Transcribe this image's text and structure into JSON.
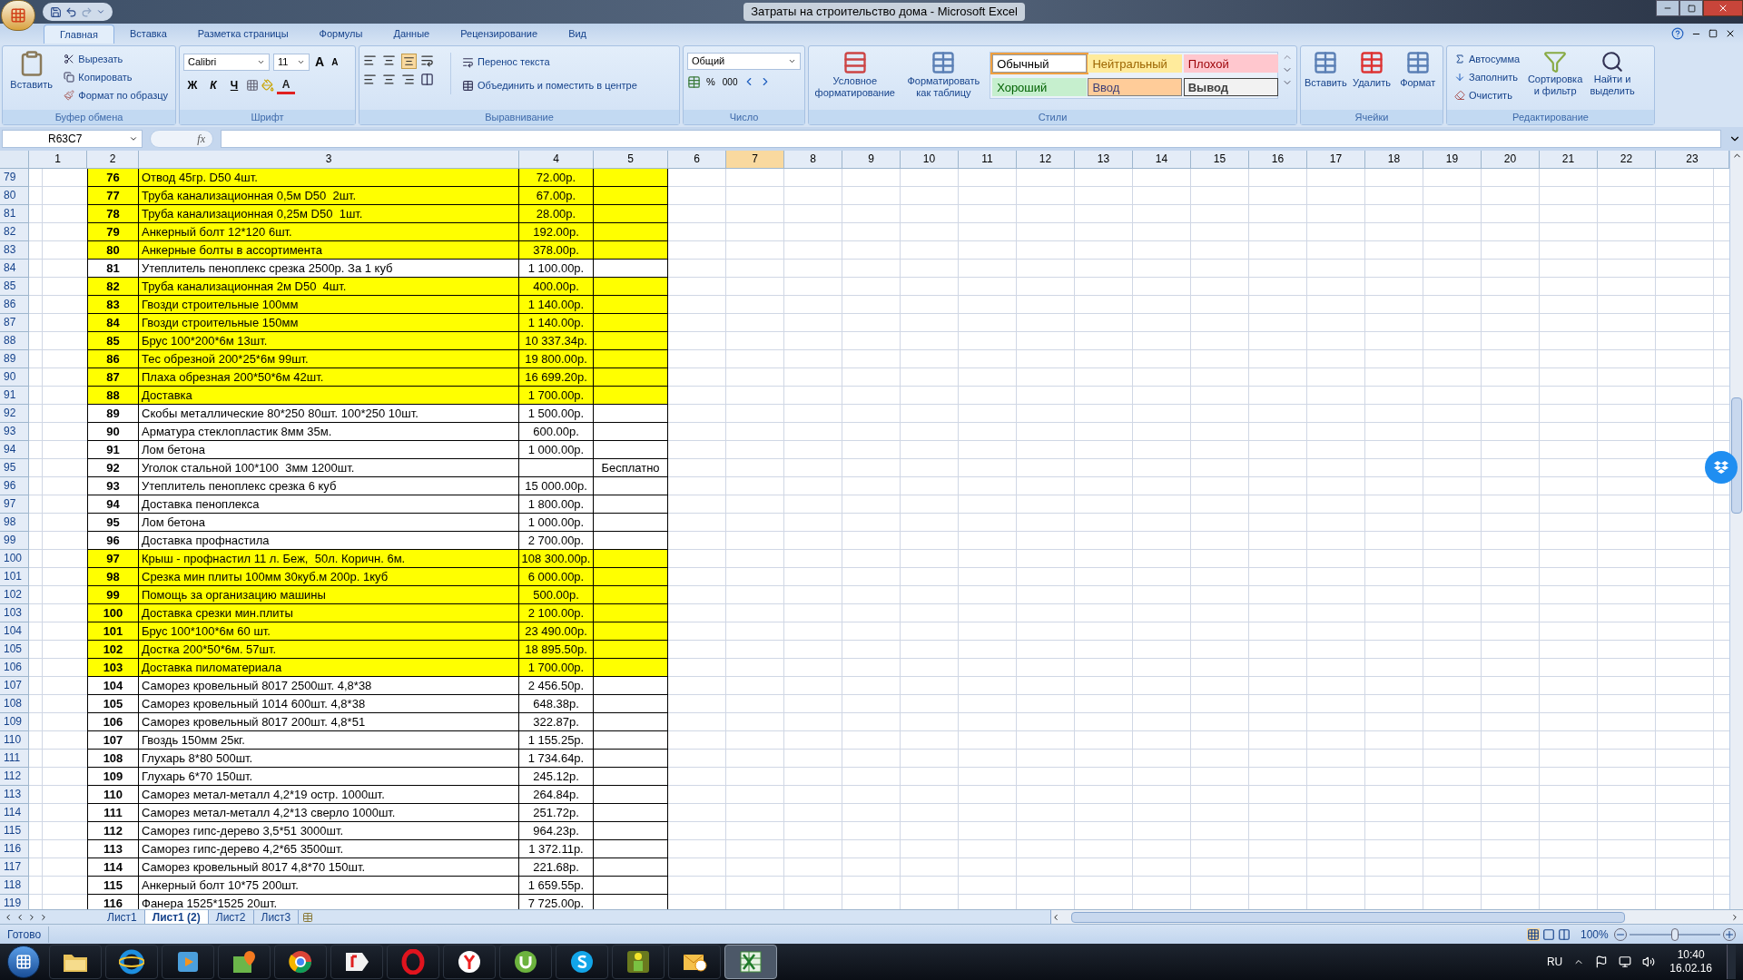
{
  "window": {
    "title": "Затраты на строительство дома - Microsoft Excel"
  },
  "ribbon_tabs": [
    {
      "label": "Главная",
      "selected": true
    },
    {
      "label": "Вставка",
      "selected": false
    },
    {
      "label": "Разметка страницы",
      "selected": false
    },
    {
      "label": "Формулы",
      "selected": false
    },
    {
      "label": "Данные",
      "selected": false
    },
    {
      "label": "Рецензирование",
      "selected": false
    },
    {
      "label": "Вид",
      "selected": false
    }
  ],
  "clipboard": {
    "paste": "Вставить",
    "cut": "Вырезать",
    "copy": "Копировать",
    "format_painter": "Формат по образцу",
    "label": "Буфер обмена"
  },
  "font": {
    "name": "Calibri",
    "size": "11",
    "grow": "A",
    "shrink": "A",
    "bold": "Ж",
    "italic": "К",
    "underline": "Ч",
    "font_color": "A",
    "label": "Шрифт"
  },
  "alignment": {
    "wrap": "Перенос текста",
    "merge": "Объединить и поместить в центре",
    "label": "Выравнивание"
  },
  "number": {
    "format": "Общий",
    "percent": "%",
    "thousands": "000",
    "label": "Число"
  },
  "styles": {
    "conditional": "Условное форматирование",
    "as_table": "Форматировать как таблицу",
    "label": "Стили",
    "items": [
      {
        "label": "Обычный",
        "kind": "normal",
        "color": "#ffffff",
        "selected": true
      },
      {
        "label": "Нейтральный",
        "kind": "neutral",
        "color": "#ffeb9c",
        "selected": false
      },
      {
        "label": "Плохой",
        "kind": "bad",
        "color": "#ffc7ce",
        "selected": false
      },
      {
        "label": "Хороший",
        "kind": "good",
        "color": "#c6efce",
        "selected": false
      },
      {
        "label": "Ввод",
        "kind": "input",
        "color": "#ffcc99",
        "selected": false
      },
      {
        "label": "Вывод",
        "kind": "output",
        "color": "#f2f2f2",
        "selected": false
      }
    ]
  },
  "cells": {
    "insert": "Вставить",
    "delete": "Удалить",
    "format": "Формат",
    "label": "Ячейки"
  },
  "editing": {
    "autosum": "Автосумма",
    "fill": "Заполнить",
    "clear": "Очистить",
    "sort": "Сортировка и фильтр",
    "find": "Найти и выделить",
    "label": "Редактирование"
  },
  "formula_bar": {
    "name_box": "R63C7",
    "fx": "fx"
  },
  "columns": [
    {
      "label": "1",
      "selected": false
    },
    {
      "label": "2",
      "selected": false
    },
    {
      "label": "3",
      "selected": false
    },
    {
      "label": "4",
      "selected": false
    },
    {
      "label": "5",
      "selected": false
    },
    {
      "label": "6",
      "selected": false
    },
    {
      "label": "7",
      "selected": true
    },
    {
      "label": "8",
      "selected": false
    },
    {
      "label": "9",
      "selected": false
    },
    {
      "label": "10",
      "selected": false
    },
    {
      "label": "11",
      "selected": false
    },
    {
      "label": "12",
      "selected": false
    },
    {
      "label": "13",
      "selected": false
    },
    {
      "label": "14",
      "selected": false
    },
    {
      "label": "15",
      "selected": false
    },
    {
      "label": "16",
      "selected": false
    },
    {
      "label": "17",
      "selected": false
    },
    {
      "label": "18",
      "selected": false
    },
    {
      "label": "19",
      "selected": false
    },
    {
      "label": "20",
      "selected": false
    },
    {
      "label": "21",
      "selected": false
    },
    {
      "label": "22",
      "selected": false
    },
    {
      "label": "23",
      "selected": false
    }
  ],
  "rows": [
    {
      "row": "79",
      "num": "76",
      "name": "Отвод 45гр. D50 4шт.",
      "price": "72.00р.",
      "highlighted": true
    },
    {
      "row": "80",
      "num": "77",
      "name": "Труба канализационная 0,5м D50  2шт.",
      "price": "67.00р.",
      "highlighted": true
    },
    {
      "row": "81",
      "num": "78",
      "name": "Труба канализационная 0,25м D50  1шт.",
      "price": "28.00р.",
      "highlighted": true
    },
    {
      "row": "82",
      "num": "79",
      "name": "Анкерный болт 12*120 6шт.",
      "price": "192.00р.",
      "highlighted": true
    },
    {
      "row": "83",
      "num": "80",
      "name": "Анкерные болты в ассортимента",
      "price": "378.00р.",
      "highlighted": true
    },
    {
      "row": "84",
      "num": "81",
      "name": "Утеплитель пеноплекс срезка 2500р. За 1 куб",
      "price": "1 100.00р.",
      "highlighted": false
    },
    {
      "row": "85",
      "num": "82",
      "name": "Труба канализационная 2м D50  4шт.",
      "price": "400.00р.",
      "highlighted": true
    },
    {
      "row": "86",
      "num": "83",
      "name": "Гвозди строительные 100мм",
      "price": "1 140.00р.",
      "highlighted": true
    },
    {
      "row": "87",
      "num": "84",
      "name": "Гвозди строительные 150мм",
      "price": "1 140.00р.",
      "highlighted": true
    },
    {
      "row": "88",
      "num": "85",
      "name": "Брус 100*200*6м 13шт.",
      "price": "10 337.34р.",
      "highlighted": true
    },
    {
      "row": "89",
      "num": "86",
      "name": "Тес обрезной 200*25*6м 99шт.",
      "price": "19 800.00р.",
      "highlighted": true
    },
    {
      "row": "90",
      "num": "87",
      "name": "Плаха обрезная 200*50*6м 42шт.",
      "price": "16 699.20р.",
      "highlighted": true
    },
    {
      "row": "91",
      "num": "88",
      "name": "Доставка",
      "price": "1 700.00р.",
      "highlighted": true
    },
    {
      "row": "92",
      "num": "89",
      "name": "Скобы металлические 80*250 80шт. 100*250 10шт.",
      "price": "1 500.00р.",
      "highlighted": false
    },
    {
      "row": "93",
      "num": "90",
      "name": "Арматура стеклопластик 8мм 35м.",
      "price": "600.00р.",
      "highlighted": false
    },
    {
      "row": "94",
      "num": "91",
      "name": "Лом бетона",
      "price": "1 000.00р.",
      "highlighted": false
    },
    {
      "row": "95",
      "num": "92",
      "name": "Уголок стальной 100*100  3мм 1200шт.",
      "note": "Бесплатно",
      "highlighted": false
    },
    {
      "row": "96",
      "num": "93",
      "name": "Утеплитель пеноплекс срезка 6 куб",
      "price": "15 000.00р.",
      "highlighted": false
    },
    {
      "row": "97",
      "num": "94",
      "name": "Доставка пеноплекса",
      "price": "1 800.00р.",
      "highlighted": false
    },
    {
      "row": "98",
      "num": "95",
      "name": "Лом бетона",
      "price": "1 000.00р.",
      "highlighted": false
    },
    {
      "row": "99",
      "num": "96",
      "name": "Доставка профнастила",
      "price": "2 700.00р.",
      "highlighted": false
    },
    {
      "row": "100",
      "num": "97",
      "name": "Крыш - профнастил 11 л. Беж,  50л. Коричн. 6м.",
      "price": "108 300.00р.",
      "highlighted": true
    },
    {
      "row": "101",
      "num": "98",
      "name": "Срезка мин плиты 100мм 30куб.м 200р. 1куб",
      "price": "6 000.00р.",
      "highlighted": true
    },
    {
      "row": "102",
      "num": "99",
      "name": "Помощь за организацию машины",
      "price": "500.00р.",
      "highlighted": true
    },
    {
      "row": "103",
      "num": "100",
      "name": "Доставка срезки мин.плиты",
      "price": "2 100.00р.",
      "highlighted": true
    },
    {
      "row": "104",
      "num": "101",
      "name": "Брус 100*100*6м 60 шт.",
      "price": "23 490.00р.",
      "highlighted": true
    },
    {
      "row": "105",
      "num": "102",
      "name": "Достка 200*50*6м. 57шт.",
      "price": "18 895.50р.",
      "highlighted": true
    },
    {
      "row": "106",
      "num": "103",
      "name": "Доставка пиломатериала",
      "price": "1 700.00р.",
      "highlighted": true
    },
    {
      "row": "107",
      "num": "104",
      "name": "Саморез кровельный 8017 2500шт. 4,8*38",
      "price": "2 456.50р.",
      "highlighted": false
    },
    {
      "row": "108",
      "num": "105",
      "name": "Саморез кровельный 1014 600шт. 4,8*38",
      "price": "648.38р.",
      "highlighted": false
    },
    {
      "row": "109",
      "num": "106",
      "name": "Саморез кровельный 8017 200шт. 4,8*51",
      "price": "322.87р.",
      "highlighted": false
    },
    {
      "row": "110",
      "num": "107",
      "name": "Гвоздь 150мм 25кг.",
      "price": "1 155.25р.",
      "highlighted": false
    },
    {
      "row": "111",
      "num": "108",
      "name": "Глухарь 8*80 500шт.",
      "price": "1 734.64р.",
      "highlighted": false
    },
    {
      "row": "112",
      "num": "109",
      "name": "Глухарь 6*70 150шт.",
      "price": "245.12р.",
      "highlighted": false
    },
    {
      "row": "113",
      "num": "110",
      "name": "Саморез метал-металл 4,2*19 остр. 1000шт.",
      "price": "264.84р.",
      "highlighted": false
    },
    {
      "row": "114",
      "num": "111",
      "name": "Саморез метал-металл 4,2*13 сверло 1000шт.",
      "price": "251.72р.",
      "highlighted": false
    },
    {
      "row": "115",
      "num": "112",
      "name": "Саморез гипс-дерево 3,5*51 3000шт.",
      "price": "964.23р.",
      "highlighted": false
    },
    {
      "row": "116",
      "num": "113",
      "name": "Саморез гипс-дерево 4,2*65 3500шт.",
      "price": "1 372.11р.",
      "highlighted": false
    },
    {
      "row": "117",
      "num": "114",
      "name": "Саморез кровельный 8017 4,8*70 150шт.",
      "price": "221.68р.",
      "highlighted": false
    },
    {
      "row": "118",
      "num": "115",
      "name": "Анкерный болт 10*75 200шт.",
      "price": "1 659.55р.",
      "highlighted": false
    },
    {
      "row": "119",
      "num": "116",
      "name": "Фанера 1525*1525 20шт.",
      "price": "7 725.00р.",
      "highlighted": false
    }
  ],
  "sheet_tabs": [
    {
      "label": "Лист1",
      "selected": false
    },
    {
      "label": "Лист1 (2)",
      "selected": true
    },
    {
      "label": "Лист2",
      "selected": false
    },
    {
      "label": "Лист3",
      "selected": false
    }
  ],
  "status_bar": {
    "status": "Готово",
    "zoom": "100%",
    "zoom_slider": {
      "level": 0.5
    }
  },
  "taskbar": {
    "apps": [
      {
        "kind": "folder",
        "selected": false
      },
      {
        "kind": "browser_blue",
        "selected": false
      },
      {
        "kind": "player",
        "selected": false
      },
      {
        "kind": "map",
        "selected": false
      },
      {
        "kind": "browser_round",
        "selected": false
      },
      {
        "kind": "tag",
        "selected": false
      },
      {
        "kind": "ring",
        "selected": false
      },
      {
        "kind": "circle_y",
        "selected": false
      },
      {
        "kind": "torrent",
        "selected": false
      },
      {
        "kind": "chat",
        "selected": false
      },
      {
        "kind": "flower",
        "selected": false
      },
      {
        "kind": "mail",
        "selected": false
      },
      {
        "kind": "sheet",
        "selected": true
      }
    ],
    "language": "RU",
    "time": "10:40",
    "date": "16.02.16"
  }
}
